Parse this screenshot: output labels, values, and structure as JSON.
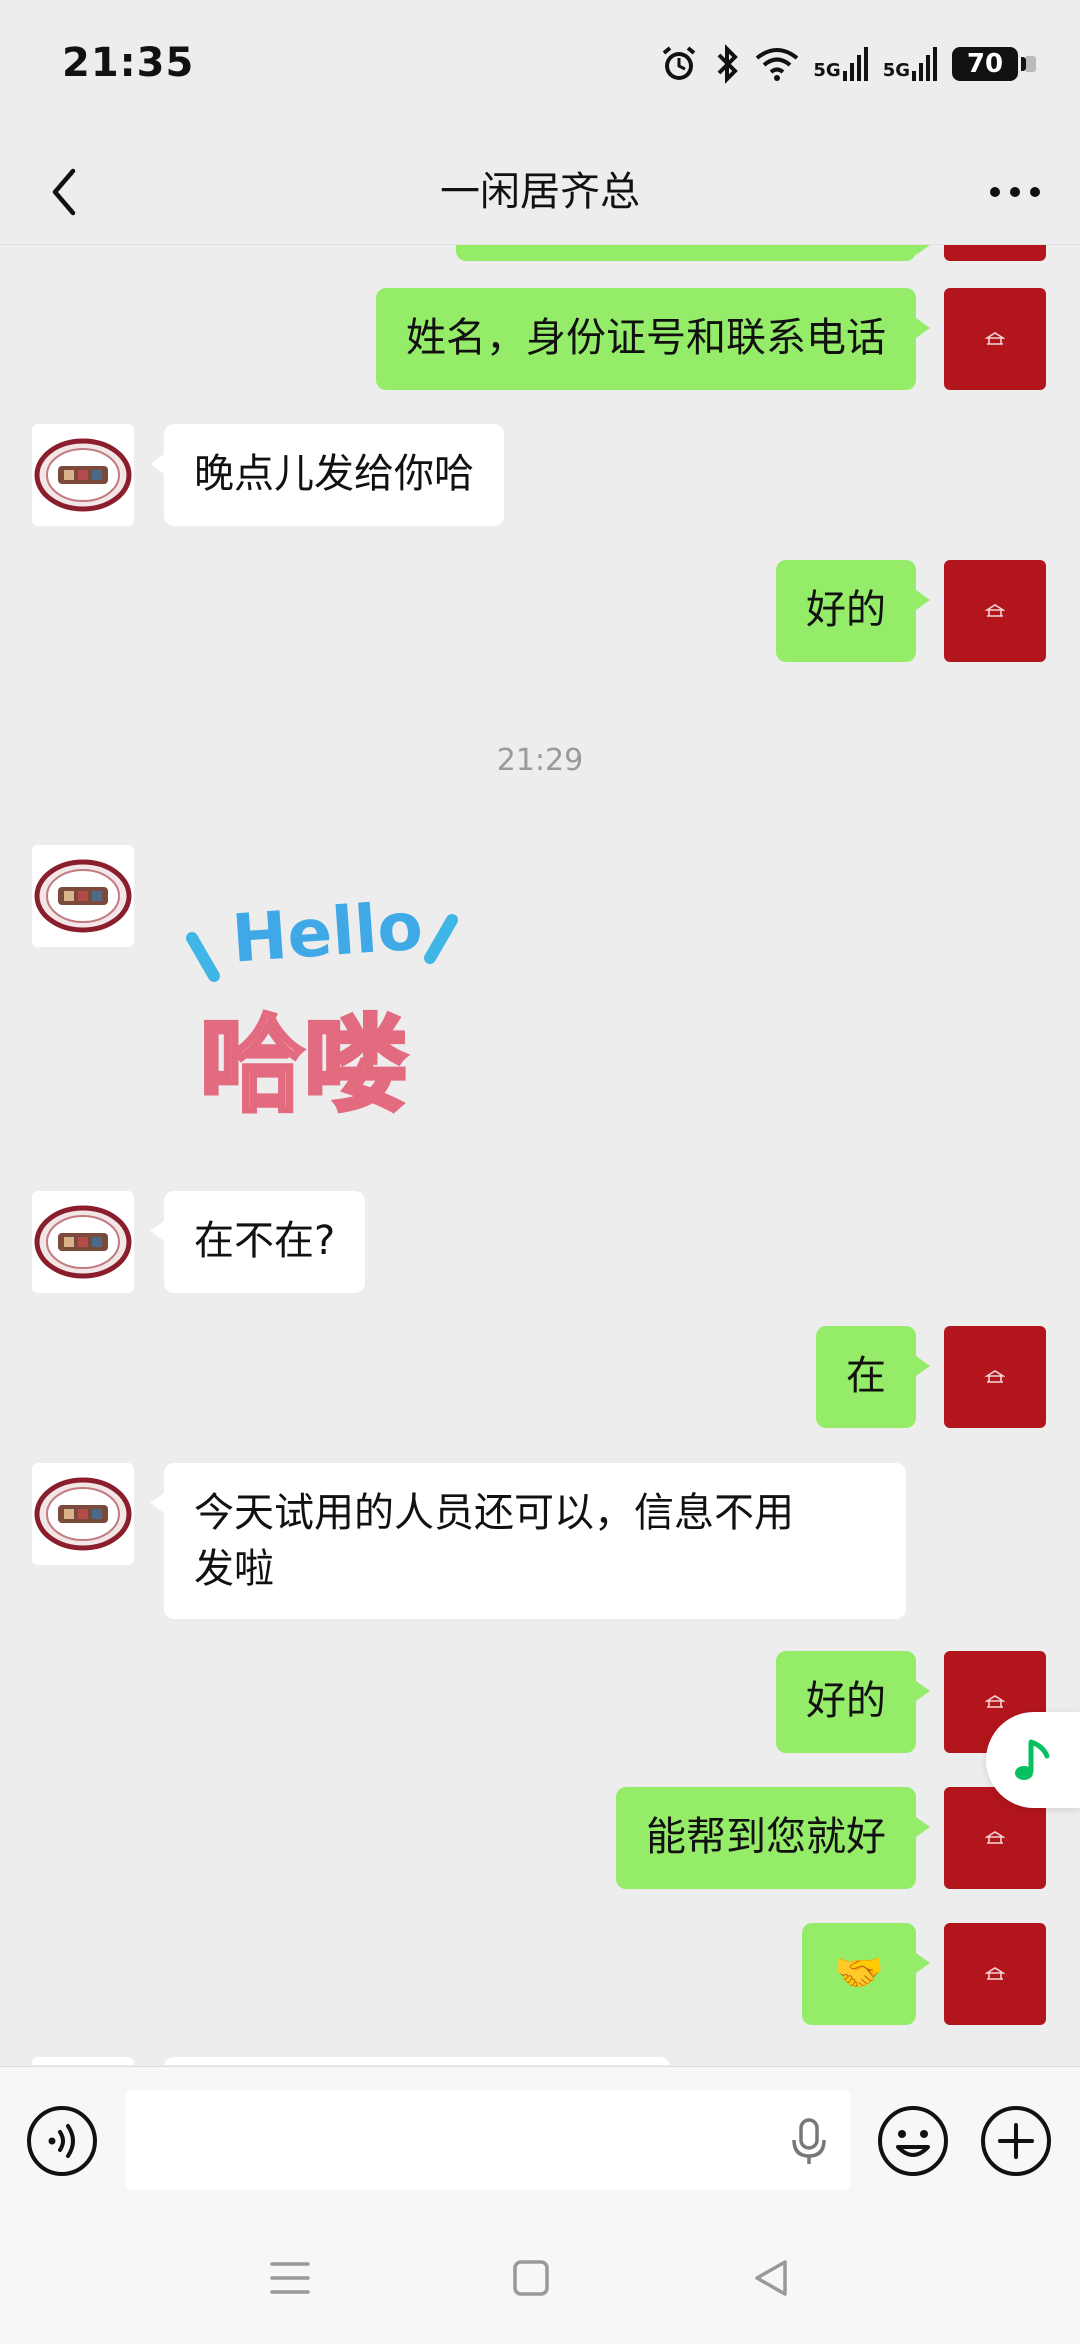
{
  "status": {
    "time": "21:35",
    "net1": "5G",
    "net2": "5G",
    "battery": "70"
  },
  "header": {
    "title": "一闲居齐总"
  },
  "messages": {
    "m1": "姓名，身份证号和联系电话",
    "m2": "晚点儿发给你哈",
    "m3": "好的",
    "time1": "21:29",
    "sticker_en": "Hello",
    "sticker_cn": "哈喽",
    "m4": "在不在?",
    "m5": "在",
    "m6_line1": "今天试用的人员还可以，信息不用",
    "m6_line2": "发啦",
    "m7": "好的",
    "m8": "能帮到您就好",
    "m9": "🤝"
  },
  "colors": {
    "bubble_me": "#95ec69",
    "bubble_other": "#ffffff",
    "avatar_me": "#b3151c",
    "background": "#ededed"
  },
  "icons": [
    "back-arrow-icon",
    "more-icon",
    "voice-icon",
    "mic-icon",
    "emoji-icon",
    "plus-icon",
    "music-note-icon",
    "menu-icon",
    "home-icon",
    "back-icon"
  ]
}
